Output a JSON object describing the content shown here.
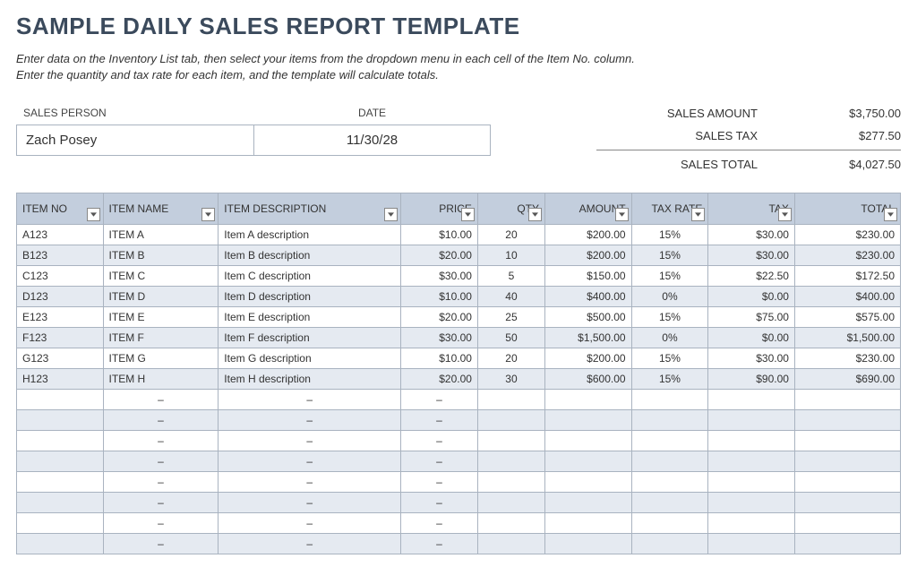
{
  "title": "SAMPLE DAILY SALES REPORT TEMPLATE",
  "instructions_line1": "Enter data on the Inventory List tab, then select your items from the dropdown menu in each cell of the Item No. column.",
  "instructions_line2": "Enter the quantity and tax rate for each item, and the template will calculate totals.",
  "meta": {
    "sales_person_label": "SALES PERSON",
    "sales_person_value": "Zach Posey",
    "date_label": "DATE",
    "date_value": "11/30/28"
  },
  "summary": {
    "amount_label": "SALES AMOUNT",
    "amount_value": "$3,750.00",
    "tax_label": "SALES TAX",
    "tax_value": "$277.50",
    "total_label": "SALES TOTAL",
    "total_value": "$4,027.50"
  },
  "headers": {
    "item_no": "ITEM NO",
    "item_name": "ITEM NAME",
    "item_desc": "ITEM DESCRIPTION",
    "price": "PRICE",
    "qty": "QTY",
    "amount": "AMOUNT",
    "tax_rate": "TAX RATE",
    "tax": "TAX",
    "total": "TOTAL"
  },
  "rows": [
    {
      "no": "A123",
      "name": "ITEM A",
      "desc": "Item A description",
      "price": "$10.00",
      "qty": "20",
      "amount": "$200.00",
      "rate": "15%",
      "tax": "$30.00",
      "total": "$230.00"
    },
    {
      "no": "B123",
      "name": "ITEM B",
      "desc": "Item B description",
      "price": "$20.00",
      "qty": "10",
      "amount": "$200.00",
      "rate": "15%",
      "tax": "$30.00",
      "total": "$230.00"
    },
    {
      "no": "C123",
      "name": "ITEM C",
      "desc": "Item C description",
      "price": "$30.00",
      "qty": "5",
      "amount": "$150.00",
      "rate": "15%",
      "tax": "$22.50",
      "total": "$172.50"
    },
    {
      "no": "D123",
      "name": "ITEM D",
      "desc": "Item D description",
      "price": "$10.00",
      "qty": "40",
      "amount": "$400.00",
      "rate": "0%",
      "tax": "$0.00",
      "total": "$400.00"
    },
    {
      "no": "E123",
      "name": "ITEM E",
      "desc": "Item E description",
      "price": "$20.00",
      "qty": "25",
      "amount": "$500.00",
      "rate": "15%",
      "tax": "$75.00",
      "total": "$575.00"
    },
    {
      "no": "F123",
      "name": "ITEM F",
      "desc": "Item F description",
      "price": "$30.00",
      "qty": "50",
      "amount": "$1,500.00",
      "rate": "0%",
      "tax": "$0.00",
      "total": "$1,500.00"
    },
    {
      "no": "G123",
      "name": "ITEM G",
      "desc": "Item G description",
      "price": "$10.00",
      "qty": "20",
      "amount": "$200.00",
      "rate": "15%",
      "tax": "$30.00",
      "total": "$230.00"
    },
    {
      "no": "H123",
      "name": "ITEM H",
      "desc": "Item H description",
      "price": "$20.00",
      "qty": "30",
      "amount": "$600.00",
      "rate": "15%",
      "tax": "$90.00",
      "total": "$690.00"
    }
  ],
  "empty_rows": 8,
  "dash": "–"
}
